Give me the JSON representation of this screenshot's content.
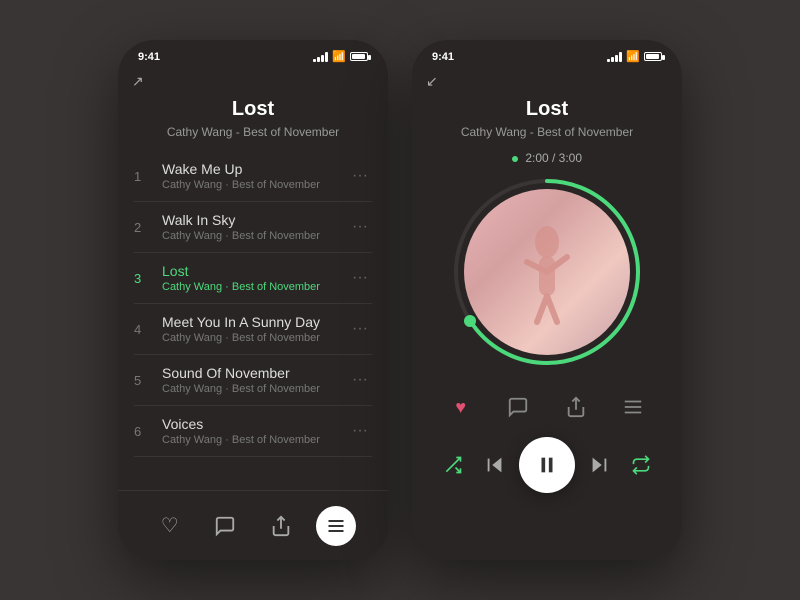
{
  "app": {
    "title": "Lost",
    "subtitle": "Cathy Wang - Best of November"
  },
  "status_bar": {
    "time": "9:41"
  },
  "tracks": [
    {
      "num": "1",
      "name": "Wake Me Up",
      "meta": "Cathy Wang · Best of November",
      "active": false
    },
    {
      "num": "2",
      "name": "Walk In Sky",
      "meta": "Cathy Wang · Best of November",
      "active": false
    },
    {
      "num": "3",
      "name": "Lost",
      "meta": "Cathy Wang · Best of November",
      "active": true
    },
    {
      "num": "4",
      "name": "Meet You In A Sunny Day",
      "meta": "Cathy Wang · Best of November",
      "active": false
    },
    {
      "num": "5",
      "name": "Sound Of November",
      "meta": "Cathy Wang · Best of November",
      "active": false
    },
    {
      "num": "6",
      "name": "Voices",
      "meta": "Cathy Wang · Best of November",
      "active": false
    }
  ],
  "player": {
    "current_time": "2:00",
    "total_time": "3:00",
    "time_display": "2:00 / 3:00"
  },
  "icons": {
    "collapse": "↙",
    "expand": "↗",
    "more": "···",
    "heart": "♥",
    "comment": "💬",
    "share": "↑",
    "list": "≡",
    "shuffle": "⇄",
    "prev": "⏮",
    "pause": "⏸",
    "next": "⏭",
    "repeat": "↻"
  },
  "colors": {
    "accent": "#4cd97b",
    "heart": "#e05070",
    "bg": "#2a2525",
    "text_primary": "#ffffff",
    "text_secondary": "#999999"
  }
}
